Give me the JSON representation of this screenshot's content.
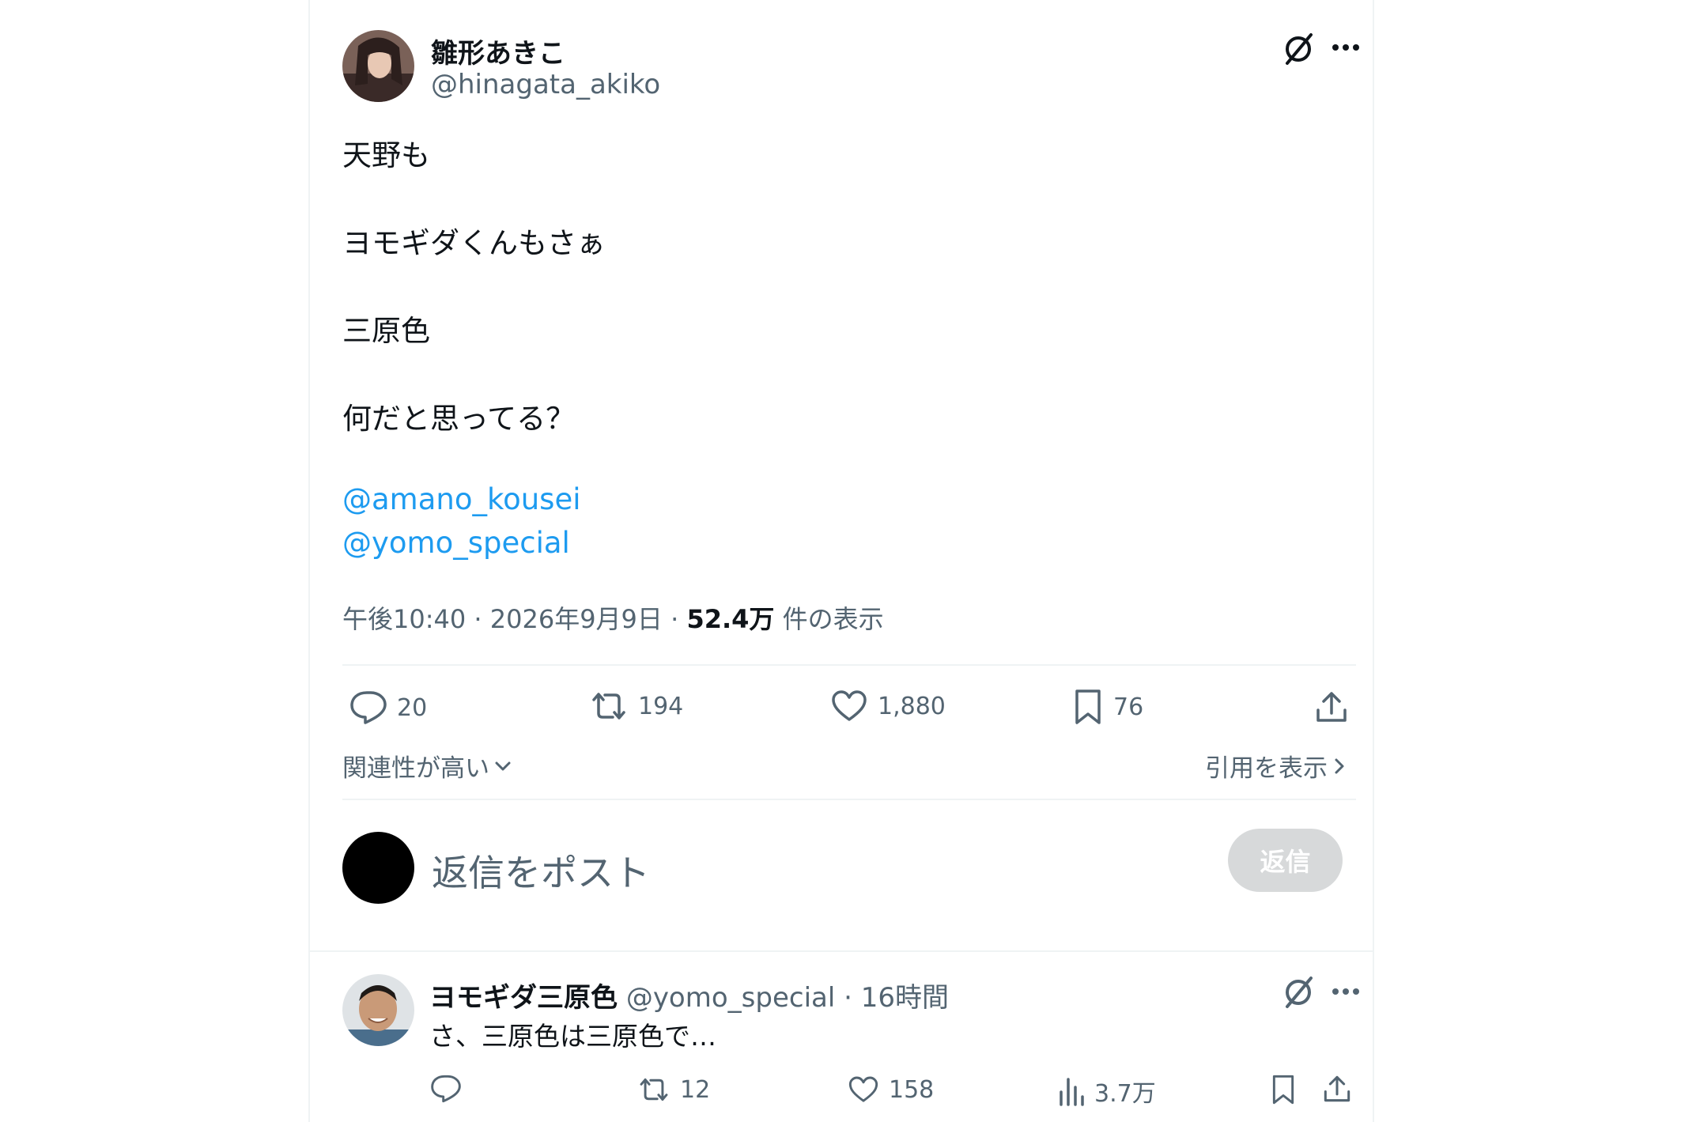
{
  "main_post": {
    "display_name": "雛形あきこ",
    "handle": "@hinagata_akiko",
    "lines": [
      "天野も",
      "ヨモギダくんもさぁ",
      "三原色",
      "何だと思ってる？"
    ],
    "mentions": [
      "@amano_kousei",
      "@yomo_special"
    ],
    "time": "午後10:40",
    "date": "2026年9月9日",
    "views_count": "52.4万",
    "views_label": "件の表示",
    "separator": "·",
    "actions": {
      "replies": "20",
      "reposts": "194",
      "likes": "1,880",
      "bookmarks": "76"
    }
  },
  "sort": {
    "label": "関連性が高い"
  },
  "quotes_link": {
    "label": "引用を表示"
  },
  "composer": {
    "placeholder": "返信をポスト",
    "reply_button": "返信"
  },
  "reply_post": {
    "display_name": "ヨモギダ三原色",
    "handle": "@yomo_special",
    "separator": "·",
    "time_ago": "16時間",
    "text": "さ、三原色は三原色で…",
    "actions": {
      "reposts": "12",
      "likes": "158",
      "views": "3.7万"
    }
  },
  "colors": {
    "accent": "#1d9bf0",
    "secondary_text": "#536471",
    "divider": "#eff3f4",
    "disabled_button": "#d7d9da"
  },
  "icons": [
    "grok-icon",
    "more-icon",
    "reply-icon",
    "repost-icon",
    "like-icon",
    "bookmark-icon",
    "share-icon",
    "views-icon",
    "chevron-down-icon",
    "chevron-right-icon"
  ]
}
